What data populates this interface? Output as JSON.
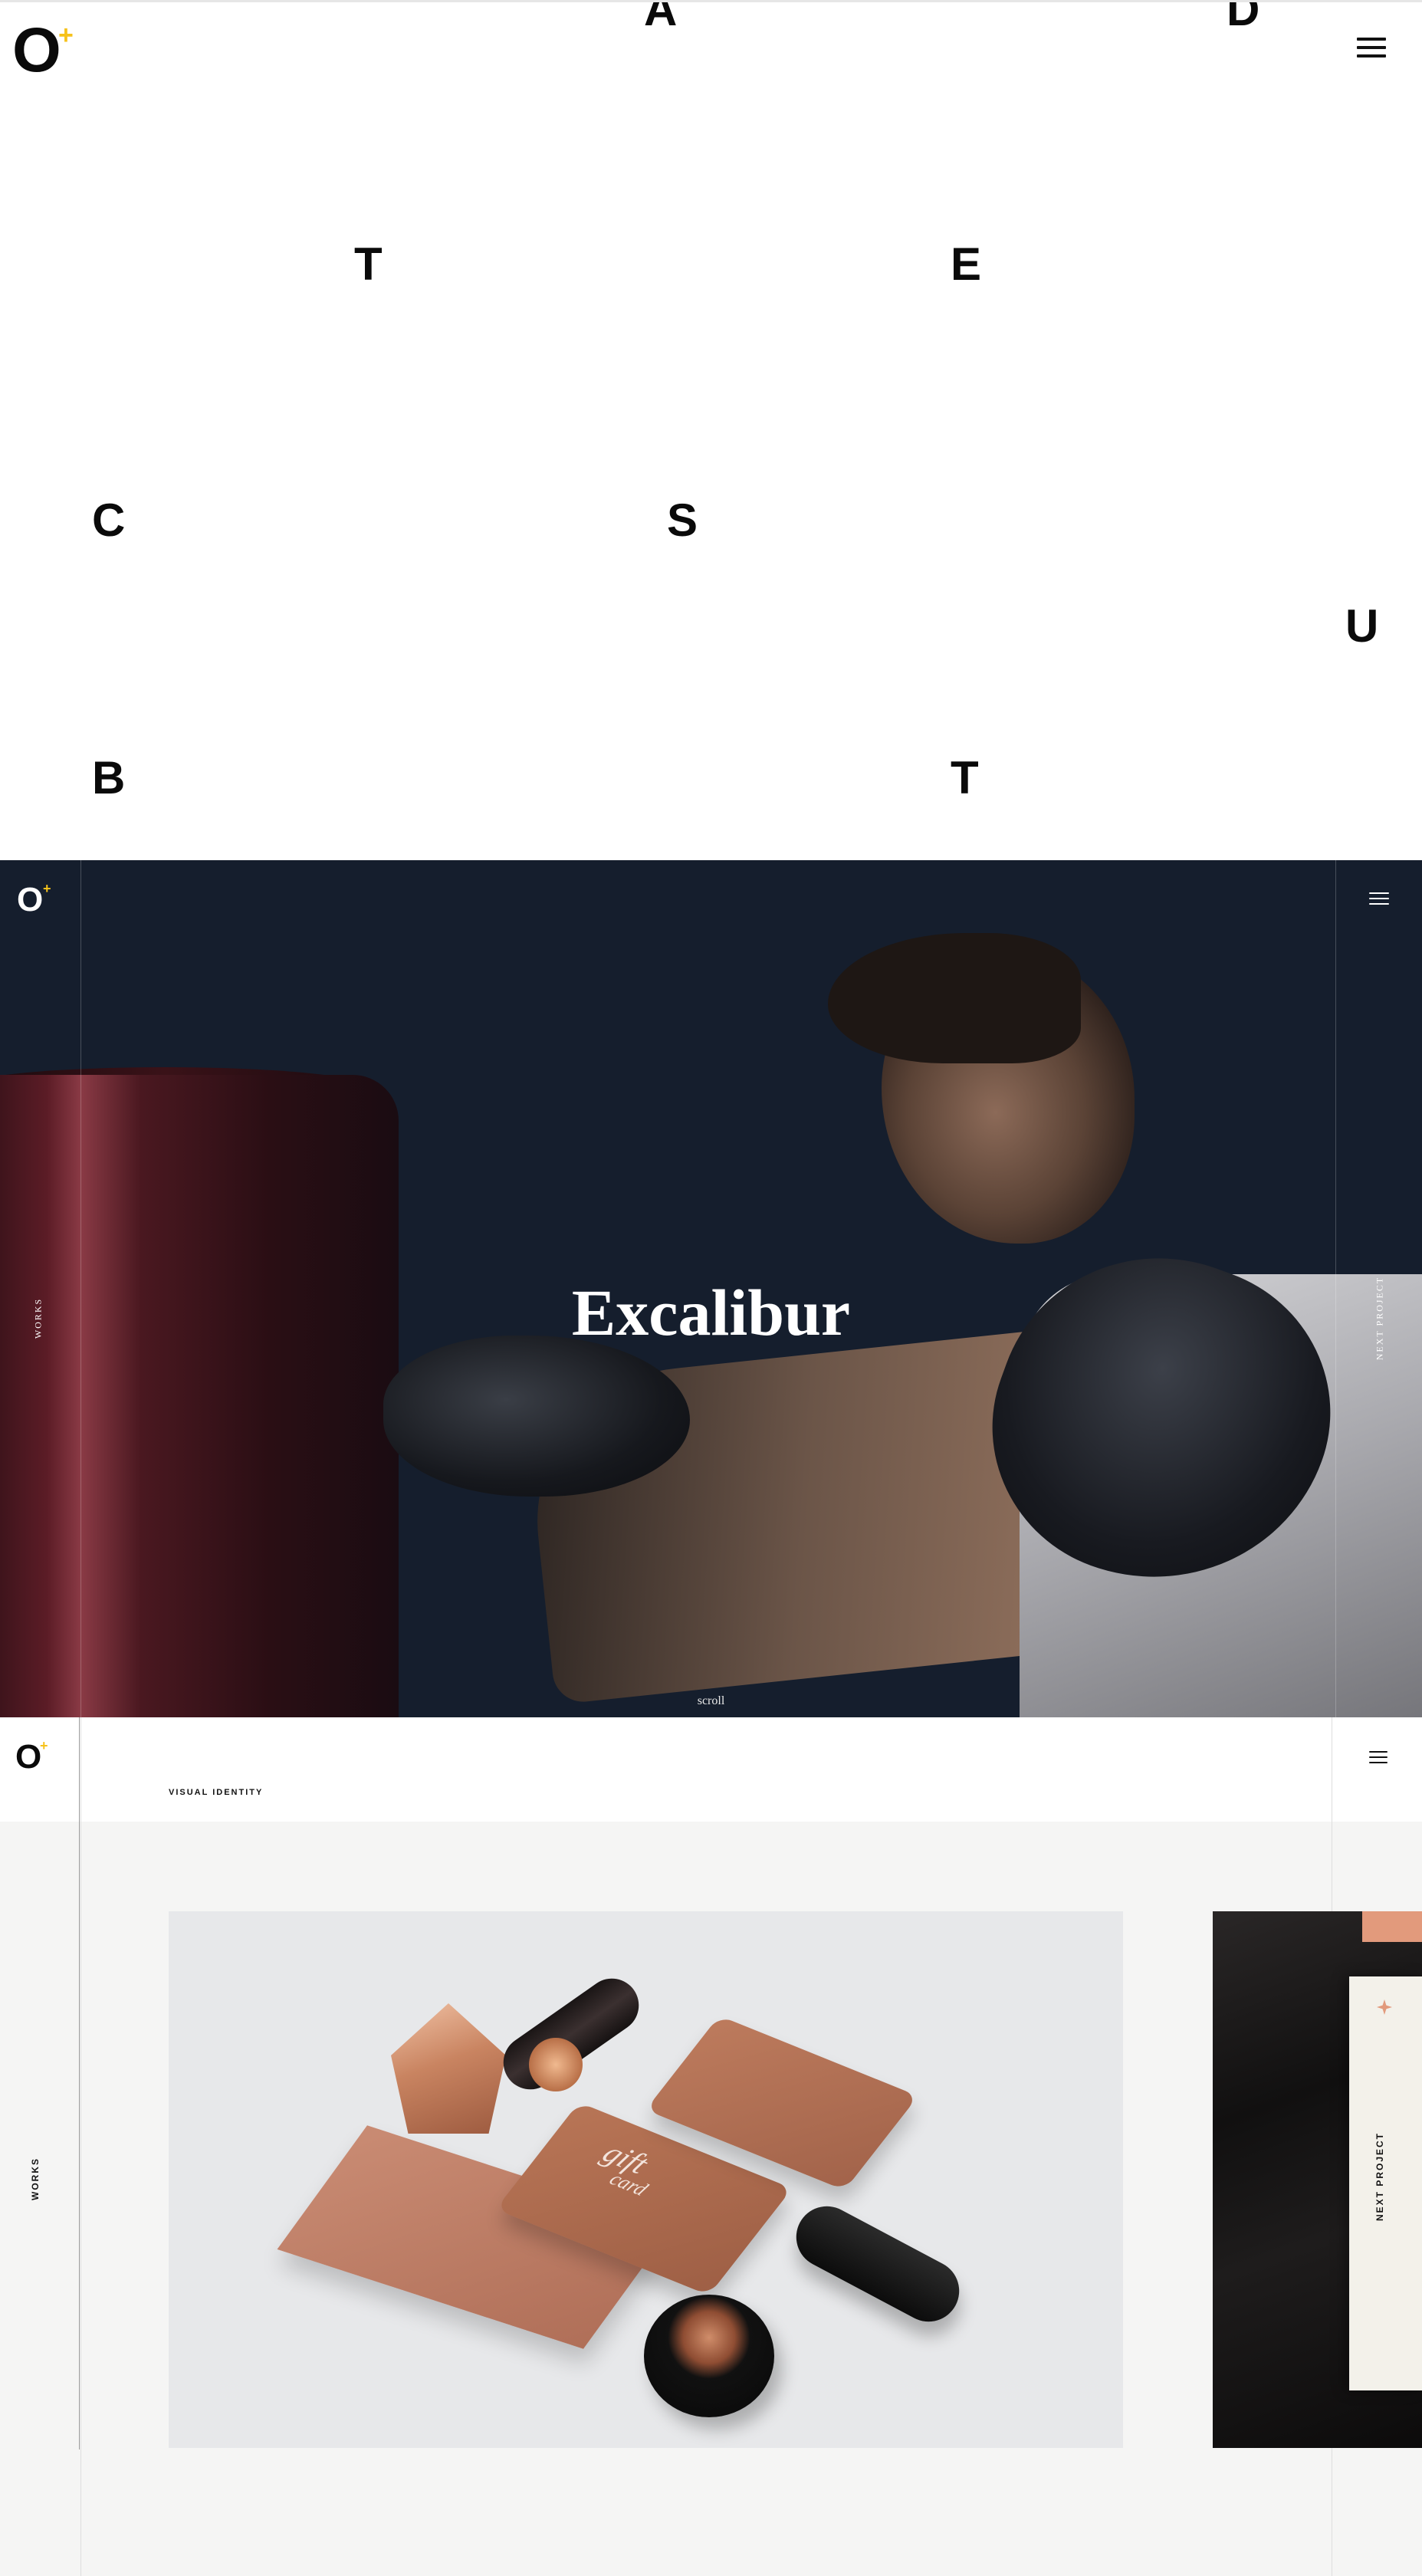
{
  "intro": {
    "logo": {
      "letter": "O",
      "mark": "+"
    },
    "menu_icon": "hamburger-icon",
    "letters": [
      "A",
      "D",
      "T",
      "E",
      "C",
      "S",
      "U",
      "B",
      "T"
    ]
  },
  "hero": {
    "logo": {
      "letter": "O",
      "mark": "+"
    },
    "menu_icon": "hamburger-icon",
    "title": "Excalibur",
    "side_left": "WORKS",
    "side_right": "NEXT PROJECT",
    "scroll_label": "scroll"
  },
  "project": {
    "logo": {
      "letter": "O",
      "mark": "+"
    },
    "menu_icon": "hamburger-icon",
    "label": "VISUAL IDENTITY",
    "side_left": "WORKS",
    "side_right": "NEXT PROJECT",
    "gift_card": {
      "line1": "gift",
      "line2": "card"
    }
  },
  "colors": {
    "accent_yellow": "#f6c21b",
    "hero_background": "#151e2d",
    "copper": "#b8775a"
  }
}
